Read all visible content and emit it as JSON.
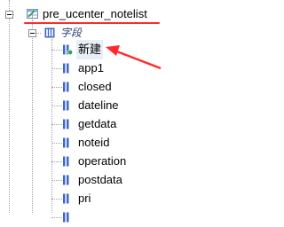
{
  "tree": {
    "table": {
      "label": "pre_ucenter_notelist",
      "icon": "table-icon"
    },
    "group": {
      "label": "字段",
      "icon": "column-group-icon"
    },
    "fields": [
      {
        "label": "新建",
        "icon": "new-field-icon"
      },
      {
        "label": "app1",
        "icon": "field-icon"
      },
      {
        "label": "closed",
        "icon": "field-icon"
      },
      {
        "label": "dateline",
        "icon": "field-icon"
      },
      {
        "label": "getdata",
        "icon": "field-icon"
      },
      {
        "label": "noteid",
        "icon": "field-icon"
      },
      {
        "label": "operation",
        "icon": "field-icon"
      },
      {
        "label": "postdata",
        "icon": "field-icon"
      },
      {
        "label": "pri",
        "icon": "field-icon"
      },
      {
        "label": "",
        "icon": "field-icon"
      }
    ]
  },
  "annotations": {
    "underline_color": "#ff2b2b",
    "arrow_color": "#ff2b2b"
  }
}
